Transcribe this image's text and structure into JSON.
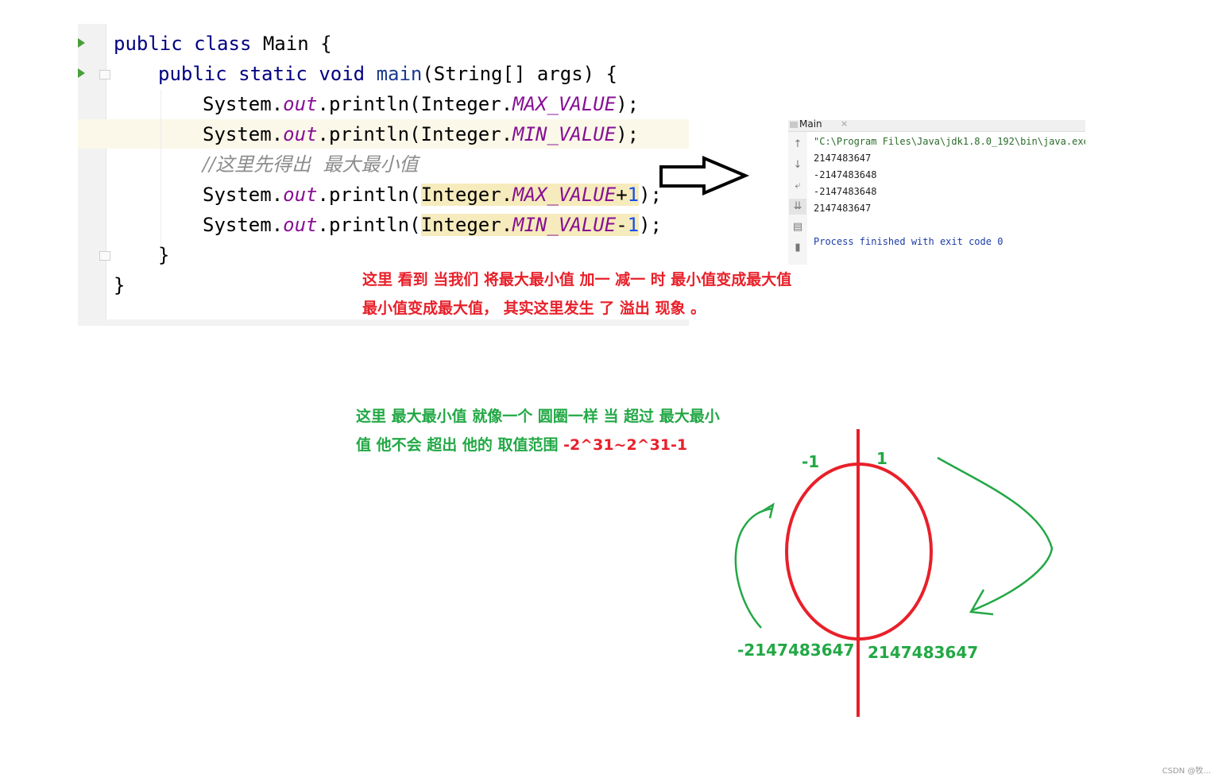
{
  "editor": {
    "lines": [
      [
        "public ",
        "class ",
        "Main {"
      ],
      [
        "public ",
        "static ",
        "void ",
        "main",
        "(String[] args) {"
      ],
      [
        "System.",
        "out",
        ".println(Integer.",
        "MAX_VALUE",
        ");"
      ],
      [
        "System.",
        "out",
        ".println(Integer.",
        "MIN_VALUE",
        ");"
      ],
      [
        "//这里先得出  最大最小值"
      ],
      [
        "System.",
        "out",
        ".println(",
        "Integer.",
        "MAX_VALUE",
        "+",
        "1",
        ");"
      ],
      [
        "System.",
        "out",
        ".println(",
        "Integer.",
        "MIN_VALUE",
        "-",
        "1",
        ");"
      ],
      [
        "}"
      ],
      [
        "}"
      ]
    ]
  },
  "console": {
    "tab_label": "Main",
    "tab_close": "×",
    "command": "\"C:\\Program Files\\Java\\jdk1.8.0_192\\bin\\java.exe\"",
    "output": [
      "2147483647",
      "-2147483648",
      "-2147483648",
      "2147483647"
    ],
    "exit_message": "Process finished with exit code 0",
    "side_icons": [
      "arrow-up-icon",
      "arrow-down-icon",
      "soft-wrap-icon",
      "scroll-to-end-icon",
      "print-icon",
      "trash-icon"
    ]
  },
  "annotations": {
    "red_line1": "这里 看到 当我们 将最大最小值 加一  减一 时 最小值变成最大值",
    "red_line2": "最小值变成最大值， 其实这里发生 了 溢出 现象 。",
    "green_line1": "这里 最大最小值 就像一个 圆圈一样 当 超过 最大最小",
    "green_line2_prefix": "值  他不会 超出 他的 取值范围  ",
    "green_line2_range": "-2^31~2^31-1"
  },
  "diagram": {
    "label_minus_one": "-1",
    "label_plus_one": "1",
    "label_min": "-2147483647",
    "label_max": "2147483647"
  },
  "watermark": "CSDN @牧...",
  "colors": {
    "annotation_red": "#e8202a",
    "annotation_green": "#22a845",
    "keyword": "#000080",
    "field": "#871094"
  }
}
